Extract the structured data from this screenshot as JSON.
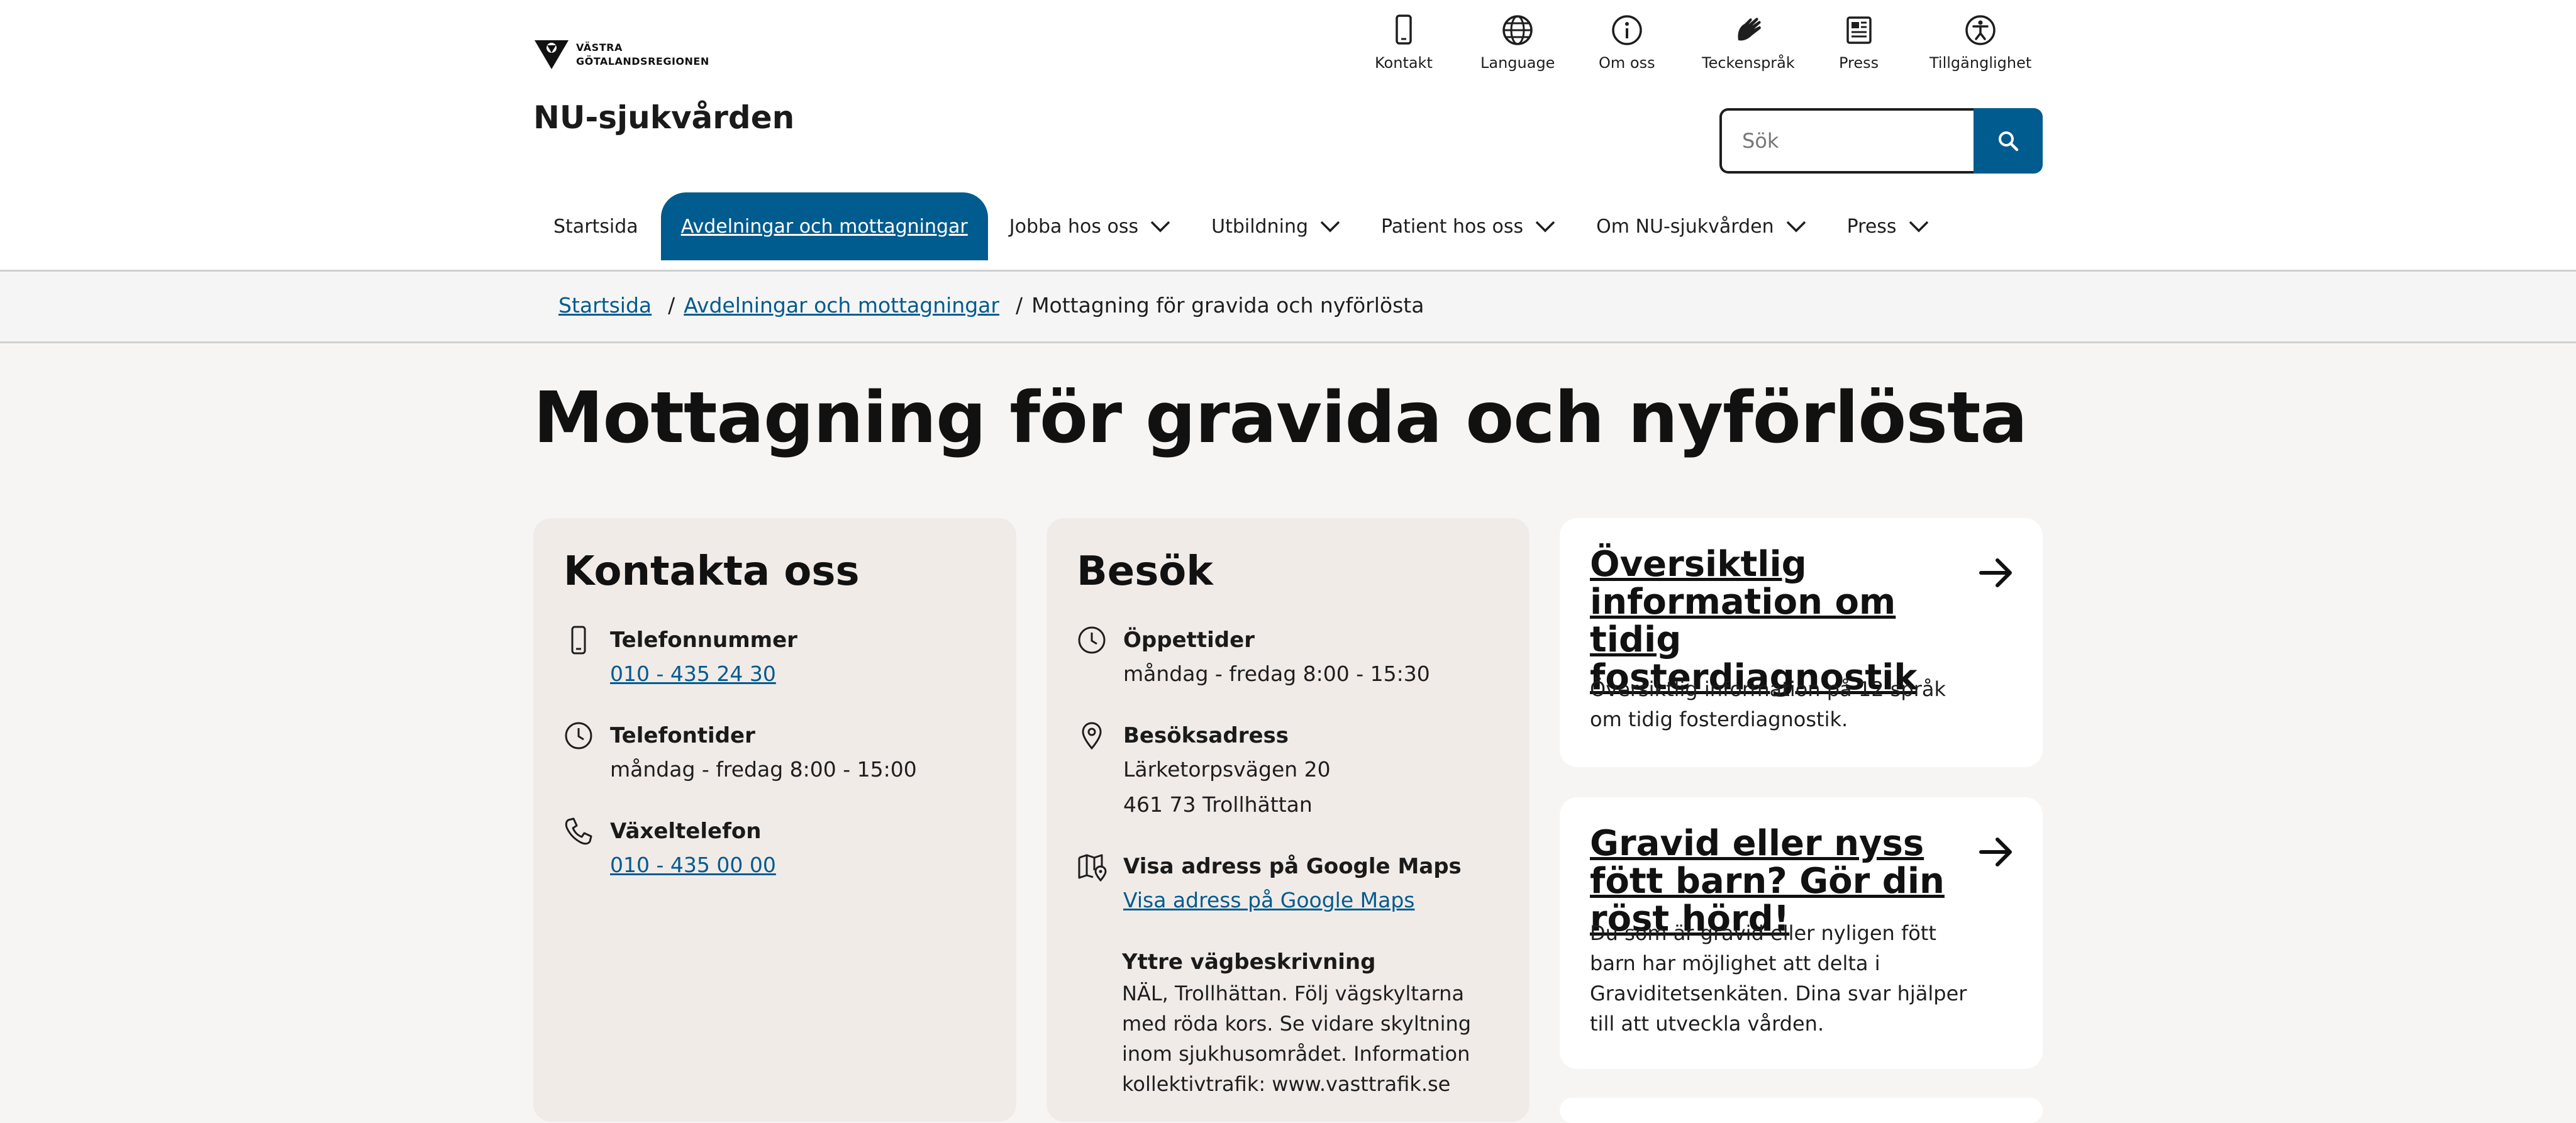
{
  "header": {
    "logo_line1": "VÄSTRA",
    "logo_line2": "GÖTALANDSREGIONEN",
    "site_title": "NU-sjukvården",
    "util_links": [
      "Kontakt",
      "Language",
      "Om oss",
      "Teckenspråk",
      "Press",
      "Tillgänglighet"
    ],
    "search_placeholder": "Sök"
  },
  "nav": {
    "items": [
      {
        "label": "Startsida",
        "dropdown": false
      },
      {
        "label": "Avdelningar och mottagningar",
        "dropdown": false,
        "active": true
      },
      {
        "label": "Jobba hos oss",
        "dropdown": true
      },
      {
        "label": "Utbildning",
        "dropdown": true
      },
      {
        "label": "Patient hos oss",
        "dropdown": true
      },
      {
        "label": "Om NU-sjukvården",
        "dropdown": true
      },
      {
        "label": "Press",
        "dropdown": true
      }
    ]
  },
  "breadcrumb": {
    "home": "Startsida",
    "section": "Avdelningar och mottagningar",
    "current": "Mottagning för gravida och nyförlösta",
    "sep": "/"
  },
  "page_title": "Mottagning för gravida och nyförlösta",
  "contact": {
    "heading": "Kontakta oss",
    "phone_label": "Telefonnummer",
    "phone_value": "010 - 435 24 30",
    "hours_label": "Telefontider",
    "hours_value": "måndag - fredag 8:00 - 15:00",
    "switch_label": "Växeltelefon",
    "switch_value": "010 - 435 00 00"
  },
  "visit": {
    "heading": "Besök",
    "open_label": "Öppettider",
    "open_value": "måndag - fredag 8:00 - 15:30",
    "address_label": "Besöksadress",
    "address_line1": "Lärketorpsvägen 20",
    "address_line2": "461 73 Trollhättan",
    "maps_label": "Visa adress på Google Maps",
    "maps_link": "Visa adress på Google Maps",
    "directions_label": "Yttre vägbeskrivning",
    "directions_text": "NÄL, Trollhättan. Följ vägskyltarna med röda kors. Se vidare skyltning inom sjukhusområdet. Information kollektivtrafik: www.vasttrafik.se"
  },
  "info_cards": [
    {
      "title": "Översiktlig information om tidig fosterdiagnostik",
      "text": "Översiktlig information på 12 språk om tidig fosterdiagnostik."
    },
    {
      "title": "Gravid eller nyss fött barn? Gör din röst hörd!",
      "text": "Du som är gravid eller nyligen fött barn har möjlighet att delta i Graviditetsenkäten. Dina svar hjälper till att utveckla vården."
    }
  ],
  "colors": {
    "accent": "#005b8e",
    "card_bg": "#f1ebe8",
    "page_bg": "#f6f5f4"
  }
}
